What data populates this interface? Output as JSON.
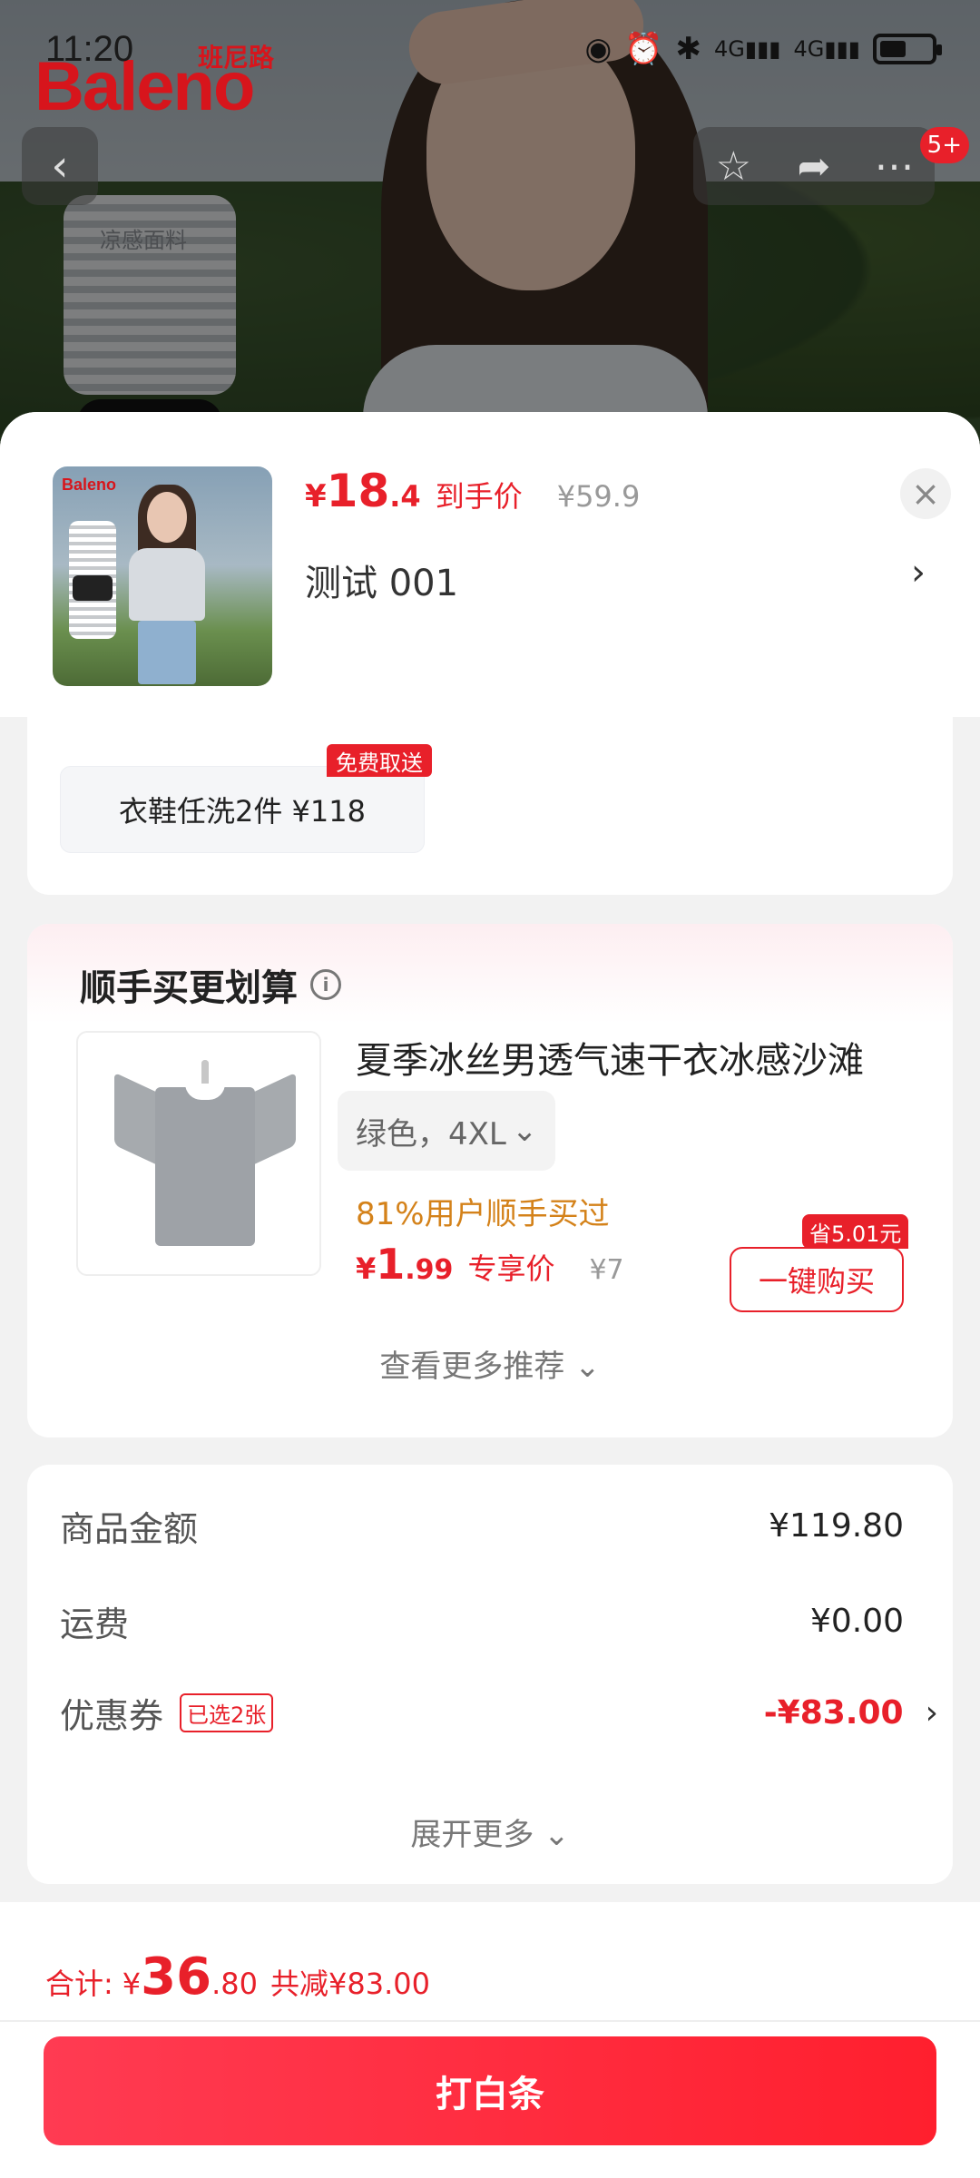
{
  "status_bar": {
    "time": "11:20",
    "network_1": "4G",
    "network_2": "4G"
  },
  "brand": {
    "logo": "Baleno",
    "name_cn": "班尼路"
  },
  "background": {
    "fabric_label": "凉感面料"
  },
  "nav": {
    "back_icon": "back-icon",
    "badge": "5+"
  },
  "product": {
    "price_currency": "¥",
    "price_int": "18",
    "price_dec": ".4",
    "price_tag": "到手价",
    "original_price": "¥59.9",
    "variant": "测试  001",
    "variant_arrow": "›",
    "close": "×"
  },
  "promo": {
    "chip_text": "衣鞋任洗2件  ¥118",
    "badge": "免费取送"
  },
  "recommend": {
    "title": "顺手买更划算",
    "info": "i",
    "name": "夏季冰丝男透气速干衣冰感沙滩",
    "spec": "绿色，4XL",
    "spec_chevron": "⌄",
    "social_proof": "81%用户顺手买过",
    "price_currency": "¥",
    "price_int": "1",
    "price_dec": ".99",
    "price_tag": "专享价",
    "original_price": "¥7",
    "save_badge": "省5.01元",
    "buy_button": "一键购买",
    "more": "查看更多推荐 ⌄"
  },
  "summary": {
    "goods_label": "商品金额",
    "goods_value": "¥119.80",
    "shipping_label": "运费",
    "shipping_value": "¥0.00",
    "coupon_label": "优惠券",
    "coupon_tag": "已选2张",
    "coupon_value": "-¥83.00",
    "coupon_arrow": "›",
    "expand": "展开更多 ⌄"
  },
  "footer": {
    "total_label": "合计:",
    "total_currency": "¥",
    "total_int": "36",
    "total_dec": ".80",
    "total_saving": "共减¥83.00",
    "pay_button": "打白条"
  },
  "colors": {
    "accent": "#e8202a",
    "social_proof": "#d4821a"
  }
}
